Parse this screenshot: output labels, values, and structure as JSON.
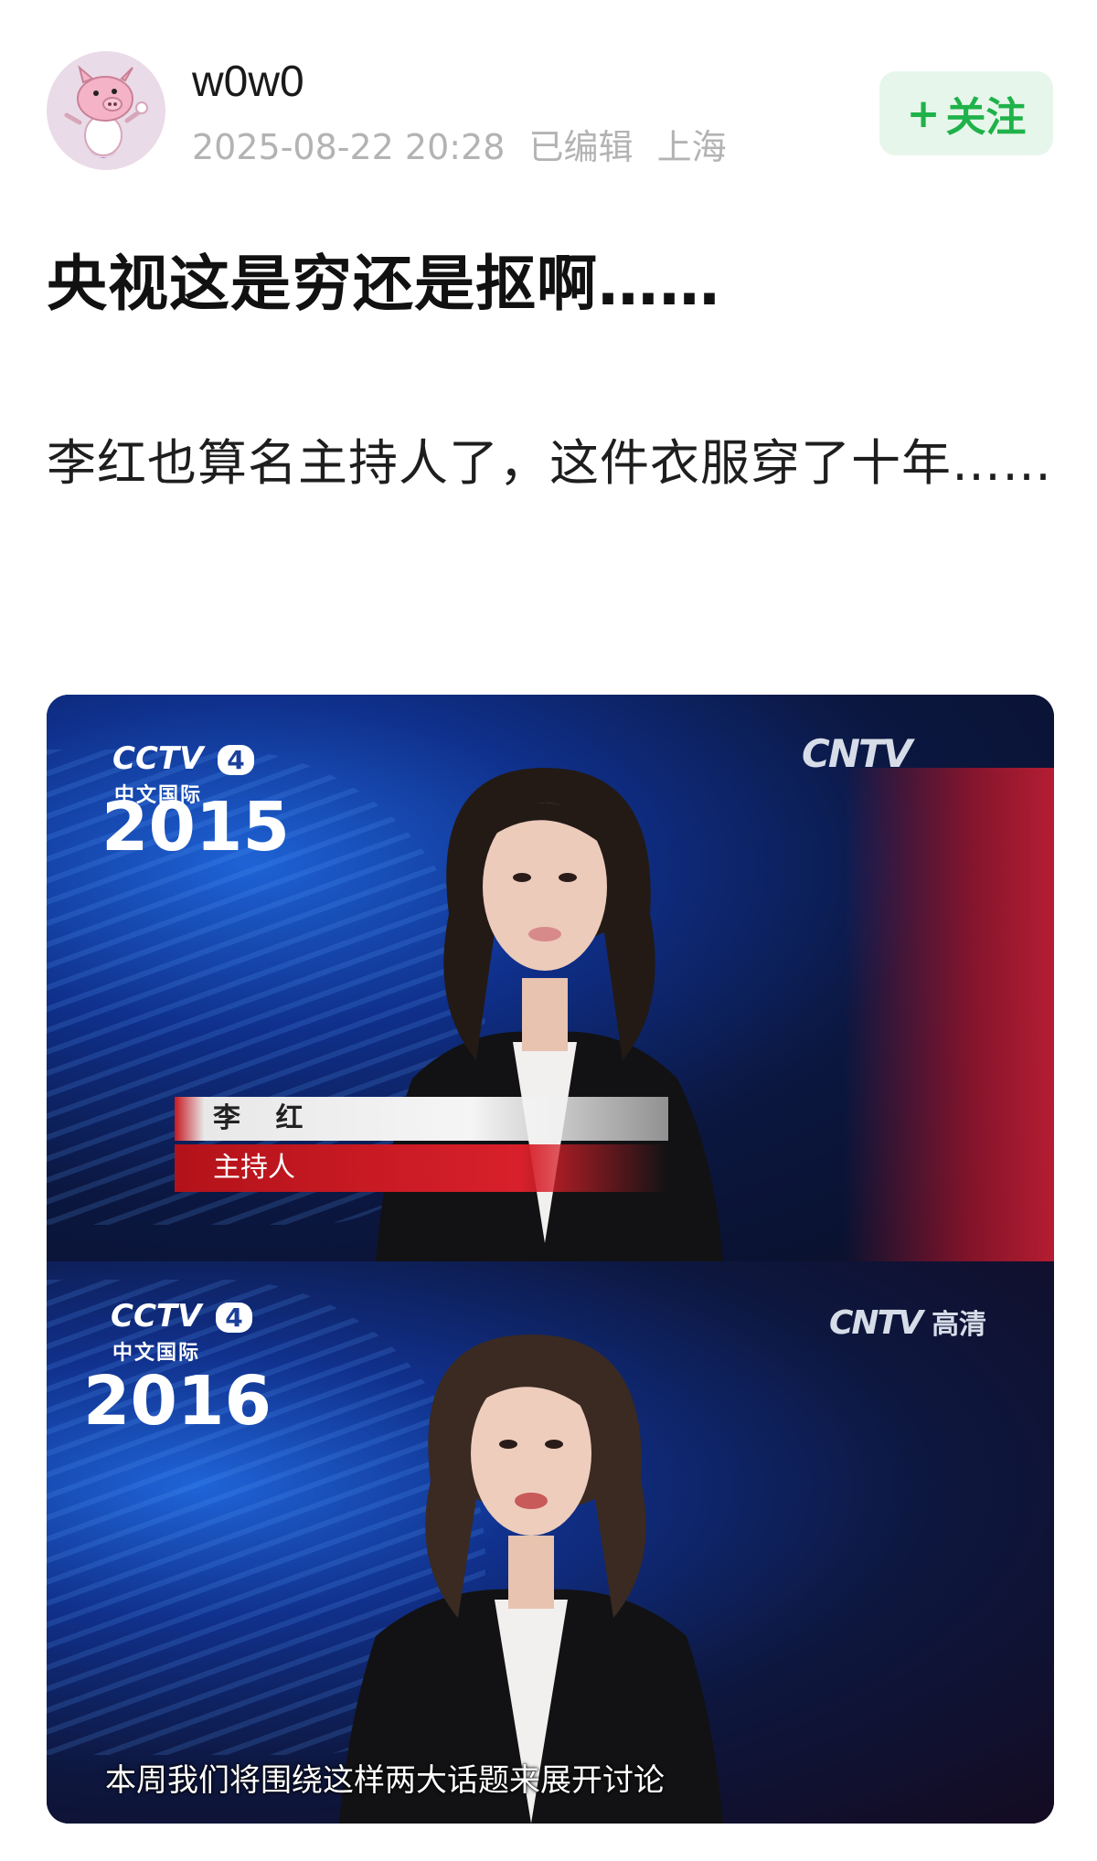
{
  "post": {
    "author": {
      "name": "w0w0",
      "avatar_icon": "pig-avatar-icon"
    },
    "meta": {
      "timestamp": "2025-08-22 20:28",
      "edited": "已编辑",
      "location": "上海"
    },
    "follow_button": {
      "plus": "+",
      "label": "关注"
    },
    "title": "央视这是穷还是抠啊……",
    "body": "李红也算名主持人了，这件衣服穿了十年……"
  },
  "media": {
    "frame1": {
      "channel_logo": "CCTV",
      "channel_number": "4",
      "channel_name": "中文国际",
      "year": "2015",
      "watermark": "CNTV",
      "name_caption": "李 红",
      "role_caption": "主持人"
    },
    "frame2": {
      "channel_logo": "CCTV",
      "channel_number": "4",
      "channel_name": "中文国际",
      "year": "2016",
      "watermark": "CNTV",
      "watermark_suffix": "高清",
      "subtitle": "本周我们将围绕这样两大话题来展开讨论"
    }
  },
  "colors": {
    "follow_text": "#1fb24a",
    "follow_bg": "#e7f6ea",
    "meta_text": "#b3b3b3"
  }
}
